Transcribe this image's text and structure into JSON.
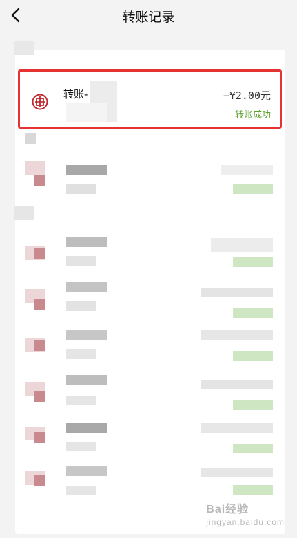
{
  "header": {
    "title": "转账记录",
    "back_icon": "chevron-left-icon"
  },
  "transaction": {
    "title": "转账-",
    "amount": "−¥2.00元",
    "status": "转账成功",
    "icon": "bank-logo-icon",
    "status_color": "#5aa02c",
    "bank_color": "#c0272d"
  },
  "watermark": {
    "text": "Bai经验",
    "subtext": "jingyan.baidu.com"
  }
}
